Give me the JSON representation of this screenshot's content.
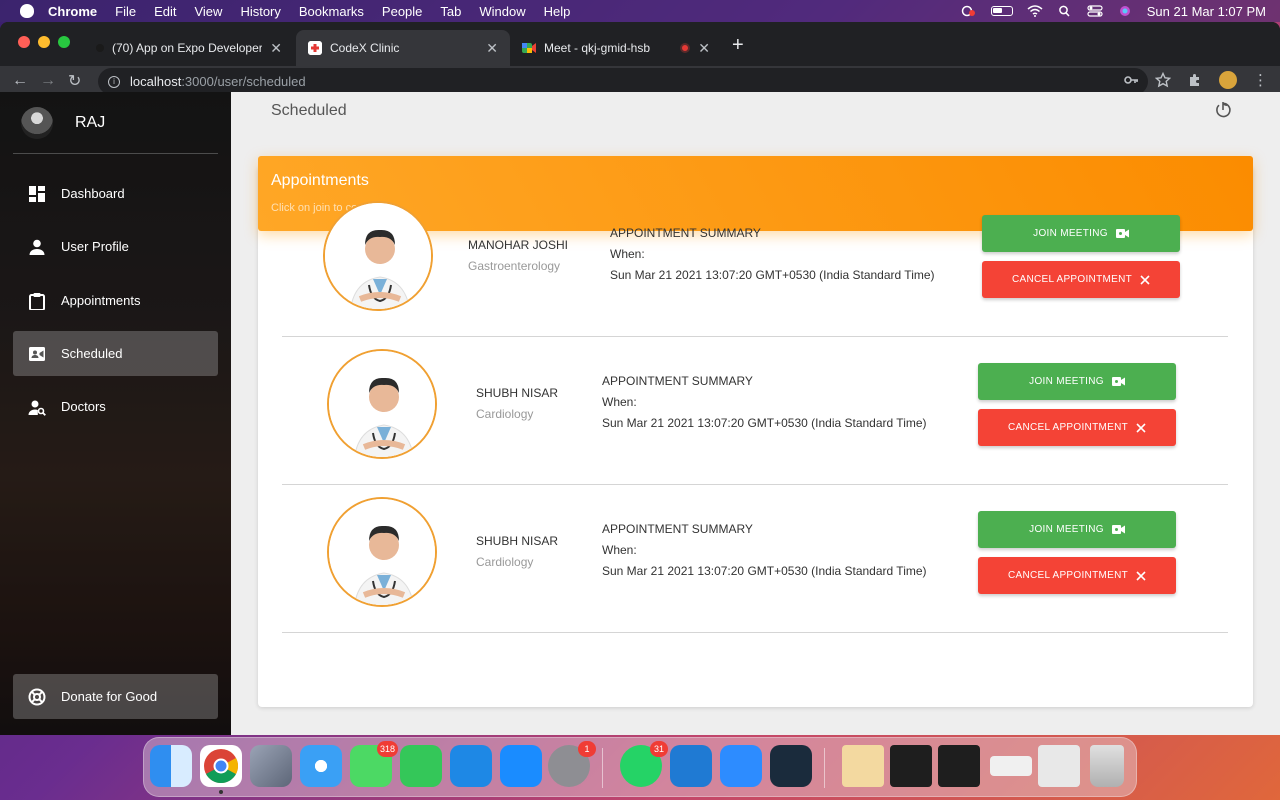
{
  "menubar": {
    "app": "Chrome",
    "items": [
      "File",
      "Edit",
      "View",
      "History",
      "Bookmarks",
      "People",
      "Tab",
      "Window",
      "Help"
    ],
    "clock": "Sun 21 Mar  1:07 PM"
  },
  "browser": {
    "tabs": [
      {
        "title": "(70) App on Expo Developer To",
        "favicon_color": "#1a73e8"
      },
      {
        "title": "CodeX Clinic",
        "favicon_color": "#e53935"
      },
      {
        "title": "Meet - qkj-gmid-hsb",
        "favicon_color": "#34a853"
      }
    ],
    "url_host": "localhost",
    "url_path": ":3000/user/scheduled"
  },
  "sidebar": {
    "user": "RAJ",
    "items": [
      {
        "label": "Dashboard",
        "icon": "dashboard-icon"
      },
      {
        "label": "User Profile",
        "icon": "person-icon"
      },
      {
        "label": "Appointments",
        "icon": "clipboard-icon"
      },
      {
        "label": "Scheduled",
        "icon": "video-camera-icon"
      },
      {
        "label": "Doctors",
        "icon": "person-search-icon"
      }
    ],
    "donate": "Donate for Good"
  },
  "page": {
    "title": "Scheduled",
    "card_title": "Appointments",
    "card_subtitle": "Click on join to continue."
  },
  "appointments": [
    {
      "doctor": "MANOHAR JOSHI",
      "specialty": "Gastroenterology",
      "summary_title": "APPOINTMENT SUMMARY",
      "when_label": "When:",
      "when": "Sun Mar 21 2021 13:07:20 GMT+0530 (India Standard Time)",
      "join_label": "JOIN MEETING",
      "cancel_label": "CANCEL APPOINTMENT"
    },
    {
      "doctor": "SHUBH NISAR",
      "specialty": "Cardiology",
      "summary_title": "APPOINTMENT SUMMARY",
      "when_label": "When:",
      "when": "Sun Mar 21 2021 13:07:20 GMT+0530 (India Standard Time)",
      "join_label": "JOIN MEETING",
      "cancel_label": "CANCEL APPOINTMENT"
    },
    {
      "doctor": "SHUBH NISAR",
      "specialty": "Cardiology",
      "summary_title": "APPOINTMENT SUMMARY",
      "when_label": "When:",
      "when": "Sun Mar 21 2021 13:07:20 GMT+0530 (India Standard Time)",
      "join_label": "JOIN MEETING",
      "cancel_label": "CANCEL APPOINTMENT"
    }
  ],
  "dock": {
    "badges": {
      "messages": "318",
      "system_preferences": "1",
      "whatsapp": "31"
    }
  },
  "colors": {
    "header_orange": "#fb8c00",
    "join_green": "#4caf50",
    "cancel_red": "#f44336"
  }
}
